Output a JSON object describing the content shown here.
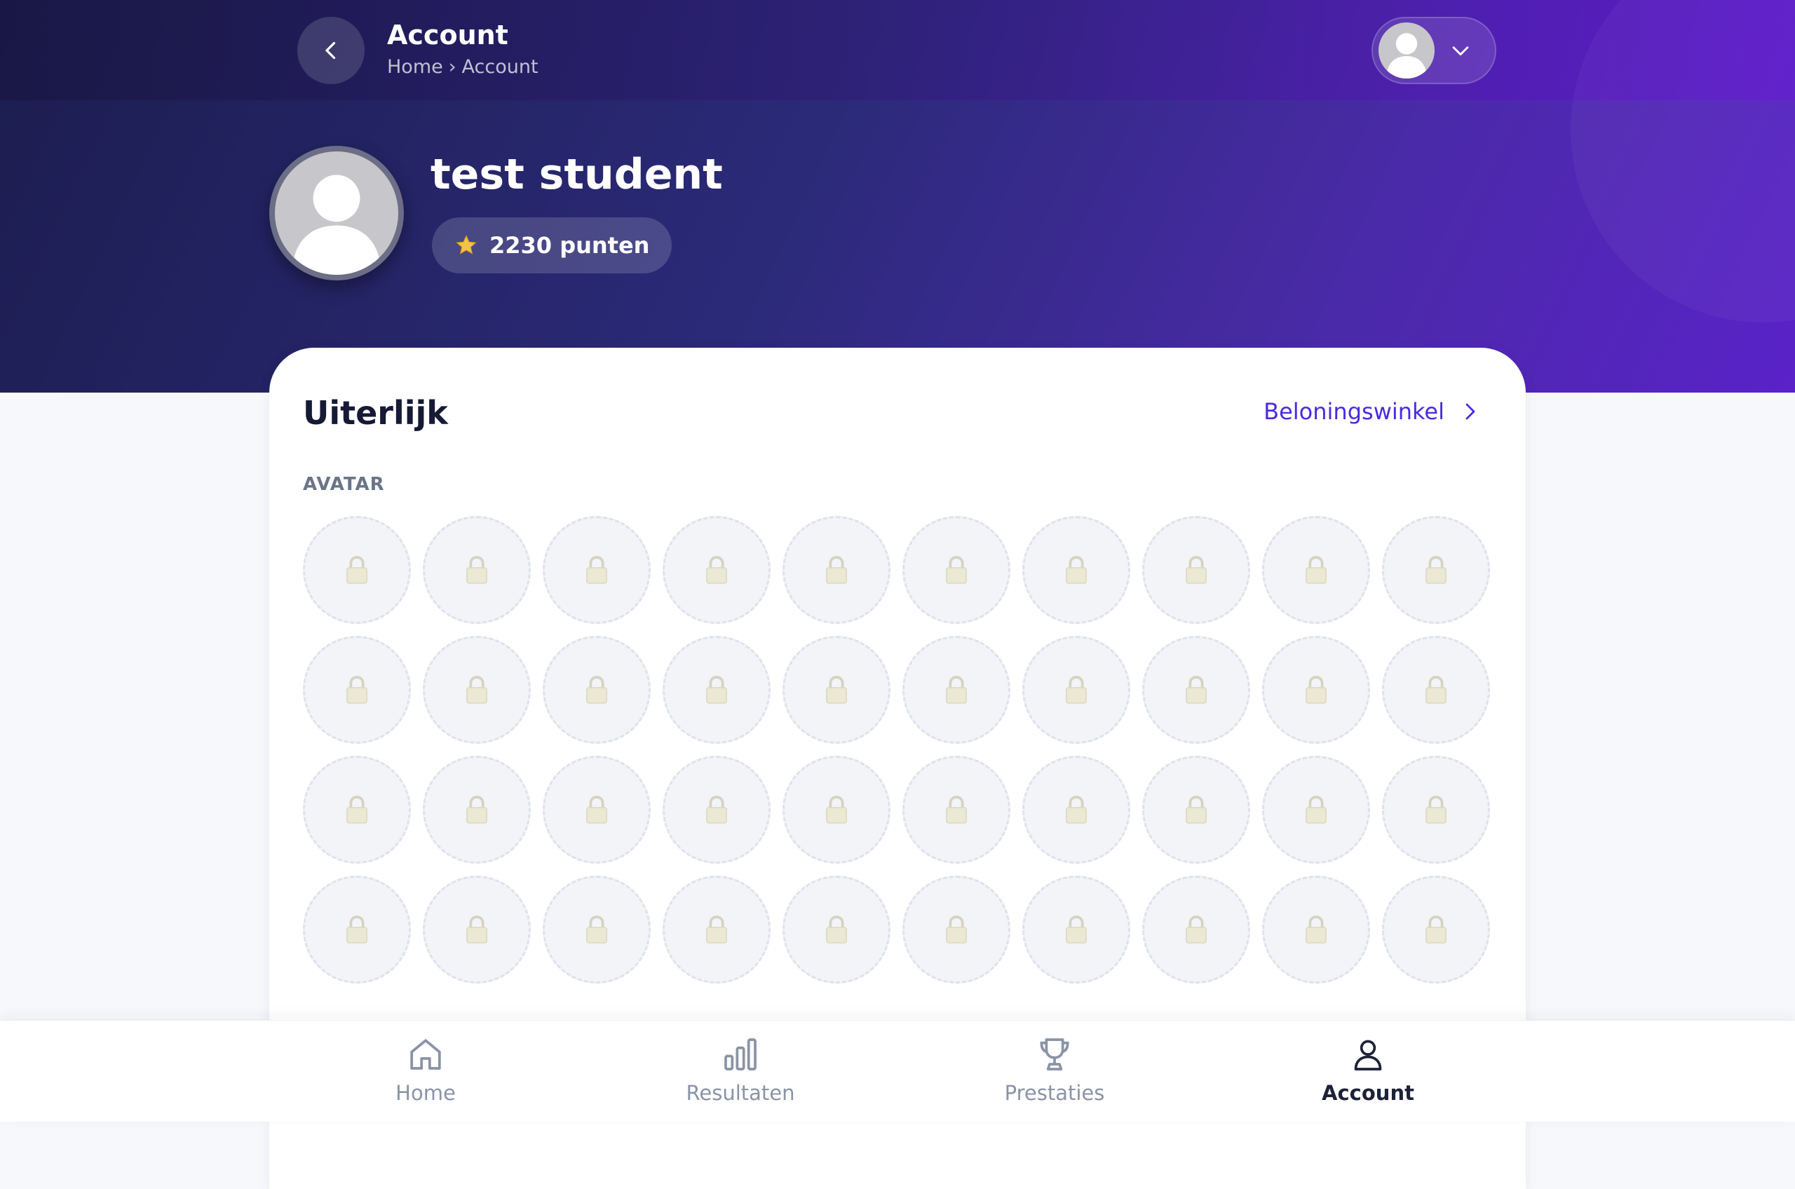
{
  "header": {
    "title": "Account",
    "breadcrumb": [
      "Home",
      "›",
      "Account"
    ]
  },
  "profile": {
    "name": "test student",
    "points_label": "2230 punten"
  },
  "appearance": {
    "title": "Uiterlijk",
    "shop_link": "Beloningswinkel",
    "section_label": "AVATAR",
    "locked_avatar_count": 40
  },
  "bottom_nav": [
    {
      "label": "Home",
      "icon": "home-icon",
      "active": false
    },
    {
      "label": "Resultaten",
      "icon": "bar-chart-icon",
      "active": false
    },
    {
      "label": "Prestaties",
      "icon": "trophy-icon",
      "active": false
    },
    {
      "label": "Account",
      "icon": "user-icon",
      "active": true
    }
  ],
  "colors": {
    "accent": "#4a2be0",
    "hero_dark": "#1c1d4f",
    "hero_purple": "#5a22c8"
  }
}
